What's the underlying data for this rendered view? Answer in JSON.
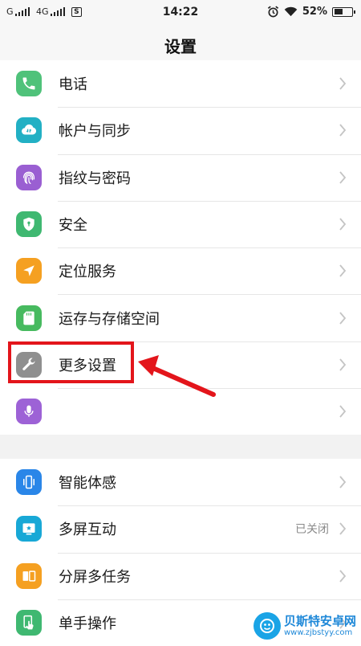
{
  "status_bar": {
    "carrier1": "G",
    "carrier2": "4G",
    "sim_badge": "S",
    "time": "14:22",
    "battery": "52%",
    "battery_level": 0.52,
    "icons": [
      "signal-icon",
      "signal-icon",
      "sim-icon",
      "alarm-icon",
      "wifi-icon",
      "battery-icon"
    ]
  },
  "header": {
    "title": "设置"
  },
  "groups": [
    {
      "items": [
        {
          "label": "电话",
          "icon": "phone-icon",
          "color": "#4fc27a"
        },
        {
          "label": "帐户与同步",
          "icon": "cloud-sync-icon",
          "color": "#22b0c4"
        },
        {
          "label": "指纹与密码",
          "icon": "fingerprint-icon",
          "color": "#9a5fd2"
        },
        {
          "label": "安全",
          "icon": "shield-icon",
          "color": "#3fb871"
        },
        {
          "label": "定位服务",
          "icon": "location-arrow-icon",
          "color": "#f5a021"
        },
        {
          "label": "运存与存储空间",
          "icon": "sd-card-icon",
          "color": "#47ba5f"
        },
        {
          "label": "更多设置",
          "icon": "wrench-icon",
          "color": "#8f8f8f"
        },
        {
          "label": "",
          "icon": "microphone-icon",
          "color": "#9d62d6"
        }
      ]
    },
    {
      "items": [
        {
          "label": "智能体感",
          "icon": "phone-motion-icon",
          "color": "#2a86e8"
        },
        {
          "label": "多屏互动",
          "icon": "screen-cast-icon",
          "color": "#18a8d6",
          "value": "已关闭"
        },
        {
          "label": "分屏多任务",
          "icon": "split-screen-icon",
          "color": "#f5a021"
        },
        {
          "label": "单手操作",
          "icon": "one-hand-icon",
          "color": "#3fb871"
        }
      ]
    }
  ],
  "annotation": {
    "highlight_color": "#e3151b"
  },
  "watermark": {
    "name": "贝斯特安卓网",
    "url": "www.zjbstyy.com"
  }
}
